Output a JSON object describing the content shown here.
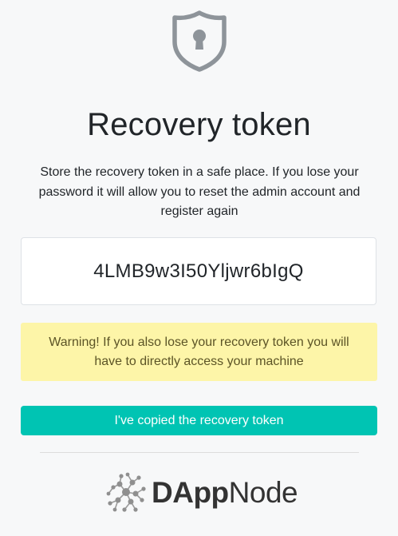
{
  "header": {
    "icon": "shield-keyhole-icon",
    "title": "Recovery token"
  },
  "instructions": {
    "text": "Store the recovery token in a safe place. If you lose your password it will allow you to reset the admin account and register again"
  },
  "token": {
    "value": "4LMB9w3I50Yljwr6bIgQ"
  },
  "warning": {
    "text": "Warning! If you also lose your recovery token you will have to directly access your machine"
  },
  "actions": {
    "copied_label": "I've copied the recovery token"
  },
  "footer": {
    "logo_icon": "dappnode-network-icon",
    "logo_prefix": "DApp",
    "logo_suffix": "Node"
  },
  "colors": {
    "accent": "#00c4b3",
    "warning_bg": "#fdf5a8",
    "icon_gray": "#8e949a"
  }
}
